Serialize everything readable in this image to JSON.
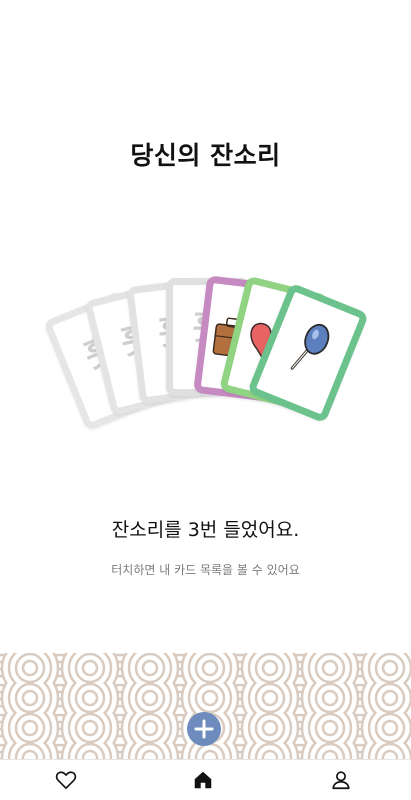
{
  "page": {
    "title": "당신의 잔소리",
    "headline": "잔소리를 3번 들었어요.",
    "subtext": "터치하면 내 카드 목록을 볼 수 있어요"
  },
  "cards": {
    "placeholder_glyph": "훗",
    "collected": [
      {
        "name": "briefcase",
        "frame_color": "#c48ac1"
      },
      {
        "name": "heart",
        "frame_color": "#8fd383"
      },
      {
        "name": "hand-mirror",
        "frame_color": "#6cc28c"
      }
    ]
  },
  "colors": {
    "accent": "#6d8bbd",
    "wave": "#d9cbc0",
    "placeholder_frame": "#dcdcdc"
  },
  "tabbar": {
    "items": [
      {
        "icon": "heart-icon"
      },
      {
        "icon": "home-icon",
        "active": true
      },
      {
        "icon": "profile-icon"
      }
    ]
  }
}
